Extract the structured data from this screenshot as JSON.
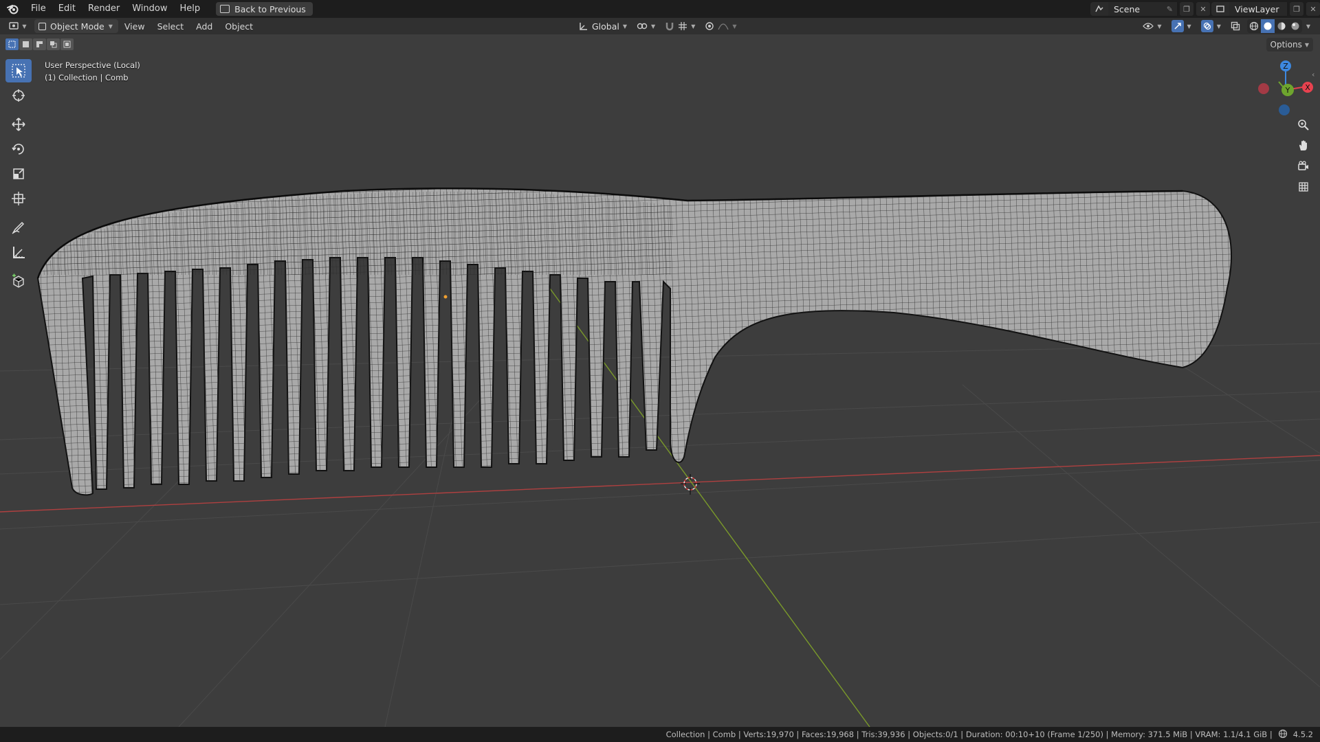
{
  "topbar": {
    "menus": [
      "File",
      "Edit",
      "Render",
      "Window",
      "Help"
    ],
    "back_button": "Back to Previous",
    "scene_name": "Scene",
    "view_layer": "ViewLayer"
  },
  "header": {
    "mode": "Object Mode",
    "menus": [
      "View",
      "Select",
      "Add",
      "Object"
    ],
    "transform_orientation": "Global",
    "options_label": "Options"
  },
  "viewport": {
    "perspective_label": "User Perspective (Local)",
    "collection_label": "(1) Collection | Comb",
    "axes": {
      "x": "X",
      "y": "Y",
      "z": "Z"
    }
  },
  "statusbar": {
    "text": "Collection | Comb | Verts:19,970 | Faces:19,968 | Tris:39,936 | Objects:0/1 | Duration: 00:10+10 (Frame 1/250) | Memory: 371.5 MiB | VRAM: 1.1/4.1 GiB |",
    "version": "4.5.2"
  },
  "colors": {
    "accent": "#4772b3",
    "axis_x": "#e8424f",
    "axis_y": "#6ea52e",
    "axis_z": "#3d88e0",
    "mesh_fill": "#a8a8a8",
    "mesh_wire": "#1f1f1f",
    "grid_bg": "#3d3d3d"
  }
}
